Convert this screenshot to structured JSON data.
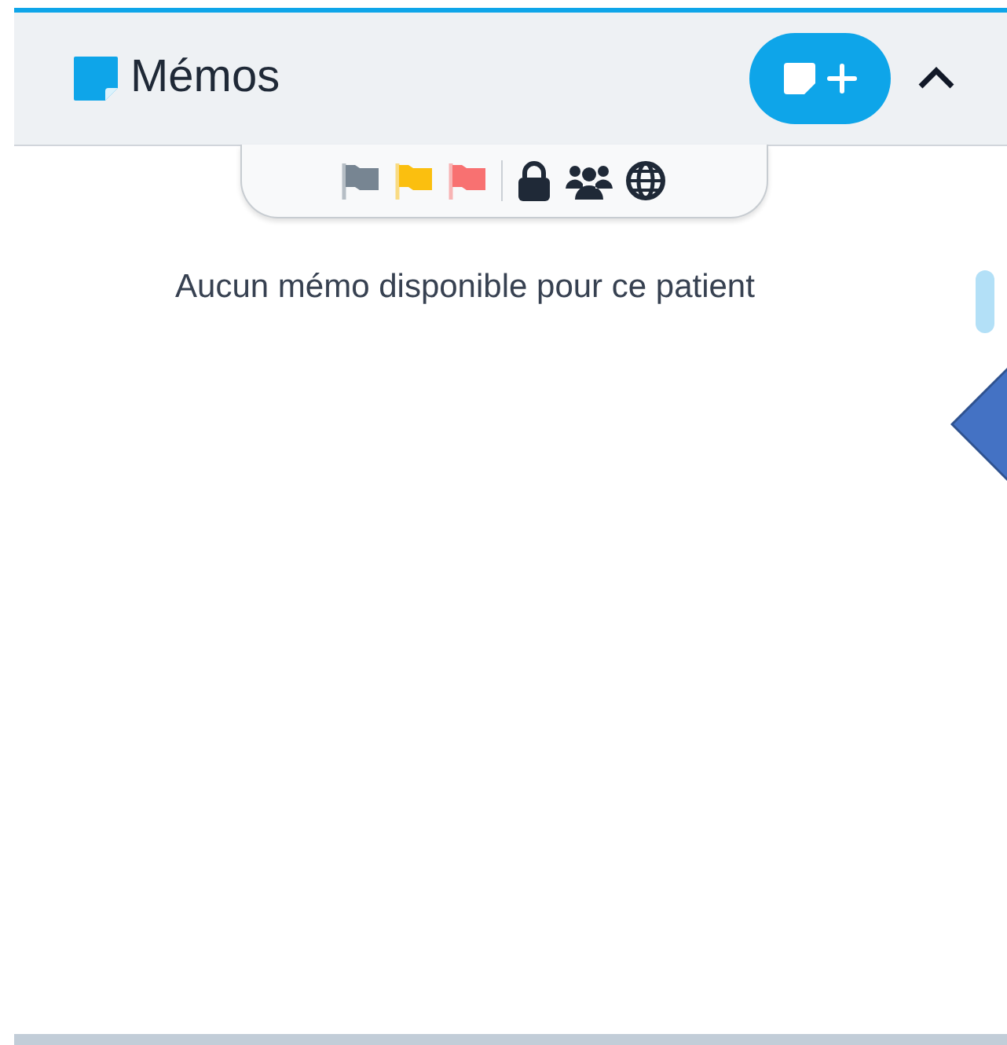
{
  "panel": {
    "title": "Mémos",
    "expanded": true
  },
  "filters": {
    "flags": [
      {
        "color": "#778592"
      },
      {
        "color": "#fbbf0f"
      },
      {
        "color": "#f87171"
      }
    ]
  },
  "empty_message": "Aucun mémo disponible pour ce patient"
}
